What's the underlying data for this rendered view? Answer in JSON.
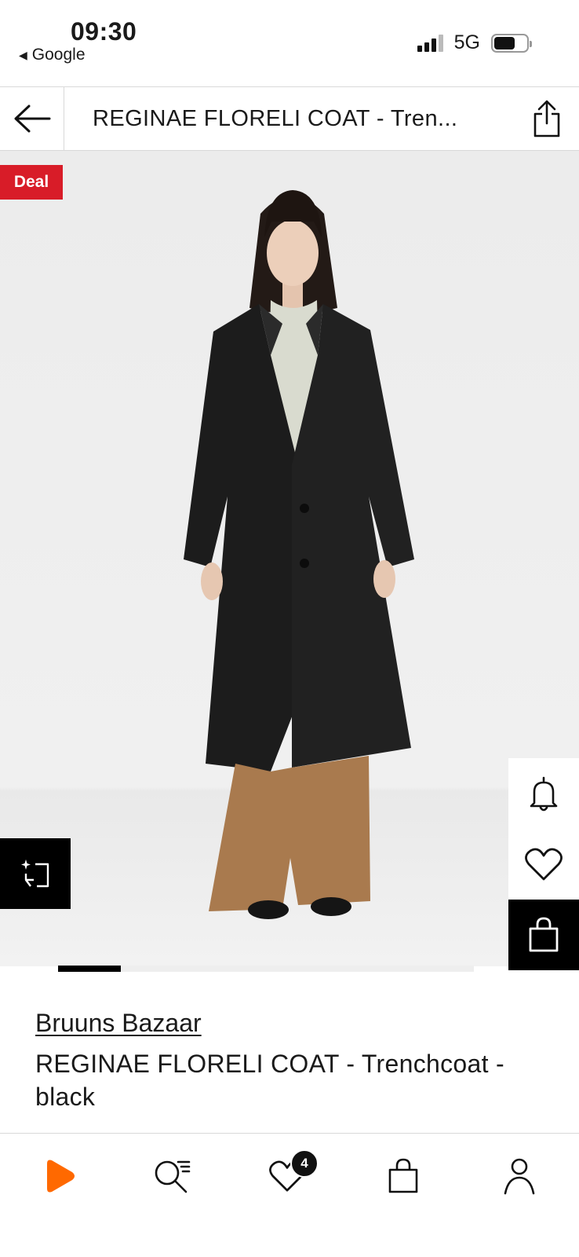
{
  "status_bar": {
    "time": "09:30",
    "back_app": "Google",
    "network": "5G"
  },
  "header": {
    "title": "REGINAE FLORELI COAT - Tren..."
  },
  "gallery": {
    "deal_label": "Deal",
    "active_page_fraction": 0.15
  },
  "product": {
    "brand": "Bruuns Bazaar",
    "name": "REGINAE FLORELI COAT - Trenchcoat - black"
  },
  "bottom_nav": {
    "items": [
      "home",
      "search",
      "wishlist",
      "bag",
      "account"
    ],
    "wishlist_count": "4"
  },
  "colors": {
    "deal": "#d81c28",
    "brand_accent": "#ff6900",
    "coat": "#1c1c1c",
    "trousers": "#a97a4e"
  }
}
